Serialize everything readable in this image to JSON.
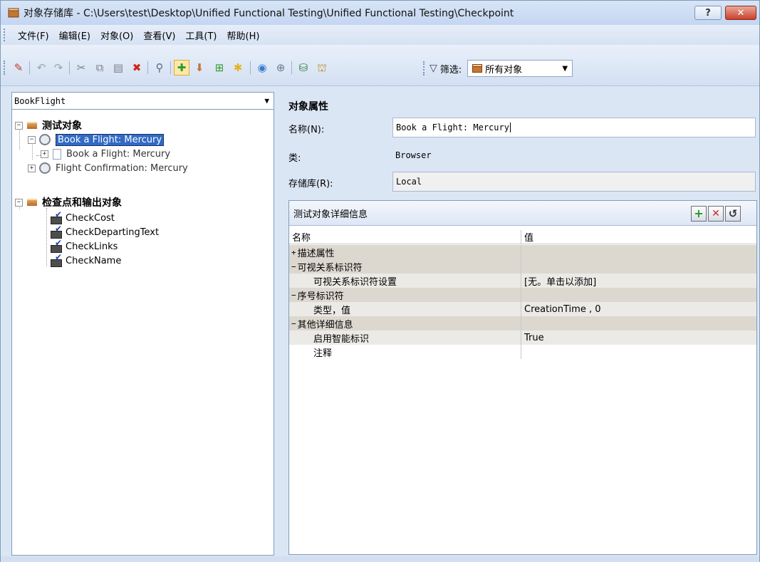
{
  "window": {
    "title": "对象存储库 - C:\\Users\\test\\Desktop\\Unified Functional Testing\\Unified Functional Testing\\Checkpoint",
    "help_glyph": "?",
    "close_glyph": "✕"
  },
  "menu": [
    "文件(F)",
    "编辑(E)",
    "对象(O)",
    "查看(V)",
    "工具(T)",
    "帮助(H)"
  ],
  "toolbar": {
    "filter_label": "筛选:",
    "filter_value": "所有对象"
  },
  "left": {
    "combo_value": "BookFlight",
    "tree": {
      "test_objects": "测试对象",
      "book_flight_browser": "Book a Flight: Mercury",
      "book_flight_page": "Book a Flight: Mercury",
      "flight_confirmation": "Flight Confirmation: Mercury",
      "checkpoints": "检查点和输出对象",
      "checkpoint_items": [
        "CheckCost",
        "CheckDepartingText",
        "CheckLinks",
        "CheckName"
      ]
    }
  },
  "properties": {
    "title": "对象属性",
    "name_label": "名称(N):",
    "name_value": "Book a Flight: Mercury",
    "class_label": "类:",
    "class_value": "Browser",
    "repo_label": "存储库(R):",
    "repo_value": "Local"
  },
  "details": {
    "title": "测试对象详细信息",
    "col_name": "名称",
    "col_value": "值",
    "rows": [
      {
        "name": "描述属性",
        "value": "",
        "type": "cat",
        "exp": "+"
      },
      {
        "name": "可视关系标识符",
        "value": "",
        "type": "cat",
        "exp": "−"
      },
      {
        "name": "可视关系标识符设置",
        "value": "[无。单击以添加]",
        "type": "sub",
        "exp": ""
      },
      {
        "name": "序号标识符",
        "value": "",
        "type": "cat",
        "exp": "−"
      },
      {
        "name": "类型，值",
        "value": "CreationTime , 0",
        "type": "sub",
        "exp": ""
      },
      {
        "name": "其他详细信息",
        "value": "",
        "type": "cat",
        "exp": "−"
      },
      {
        "name": "启用智能标识",
        "value": "True",
        "type": "sub",
        "exp": ""
      },
      {
        "name": "注释",
        "value": "",
        "type": "plain",
        "exp": ""
      }
    ]
  }
}
